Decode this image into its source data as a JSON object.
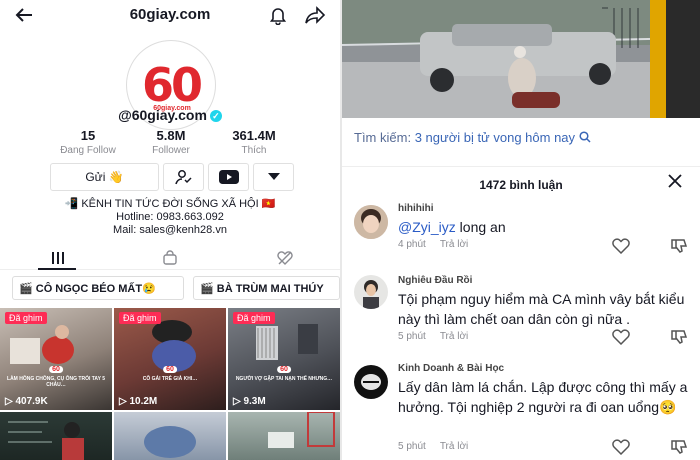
{
  "profile": {
    "header_title": "60giay.com",
    "username": "@60giay.com",
    "avatar_logo": "60",
    "avatar_caption": "60giay.com",
    "stats": [
      {
        "value": "15",
        "label": "Đang Follow"
      },
      {
        "value": "5.8M",
        "label": "Follower"
      },
      {
        "value": "361.4M",
        "label": "Thích"
      }
    ],
    "buttons": {
      "message_label": "Gửi 👋"
    },
    "bio": {
      "line1": "📲 KÊNH TIN TỨC ĐỜI SỐNG XÃ HỘI 🇻🇳",
      "line2": "Hotline: 0983.663.092",
      "line3": "Mail: sales@kenh28.vn"
    },
    "playlists": [
      "🎬 CÔ NGỌC BÉO MẤT😢",
      "🎬 BÀ TRÙM MAI THÚY"
    ],
    "videos": [
      {
        "pinned": "Đã ghim",
        "views": "▷ 407.9K",
        "logo": "60",
        "caption": "LÀM HỒNG CHỒNG, CỤ ÔNG TRÓI TAY 5 CHÁU…"
      },
      {
        "pinned": "Đã ghim",
        "views": "▷ 10.2M",
        "logo": "60",
        "caption": "CÔ GÁI TRẺ GIÀ KHI…"
      },
      {
        "pinned": "Đã ghim",
        "views": "▷ 9.3M",
        "logo": "60",
        "caption": "NGƯỜI VỢ GẶP TAI NẠN THẾ NHƯNG…"
      }
    ]
  },
  "search": {
    "prefix": "Tìm kiếm:",
    "query": "3 người bị tử vong hôm nay"
  },
  "comments": {
    "count_label": "1472 bình luận",
    "reply_label": "Trả lời",
    "items": [
      {
        "name": "hihihihi",
        "mention": "@Zyi_iyz",
        "text": " long an",
        "time": "4 phút"
      },
      {
        "name": "Nghiêu Đầu Rồi",
        "mention": "",
        "text": "Tội phạm nguy hiểm mà CA mình vây bắt kiểu này thì làm chết oan dân còn gì nữa .",
        "time": "5 phút"
      },
      {
        "name": "Kinh Doanh & Bài Học",
        "mention": "",
        "text": "Lấy dân làm lá chắn. Lập được công thì mấy a hưởng. Tội nghiệp 2 người ra đi oan uổng🥺",
        "time": "5 phút"
      }
    ]
  },
  "colors": {
    "brand_red": "#e0282e",
    "pinned_red": "#fe2c55",
    "link_blue": "#3a66b6"
  }
}
